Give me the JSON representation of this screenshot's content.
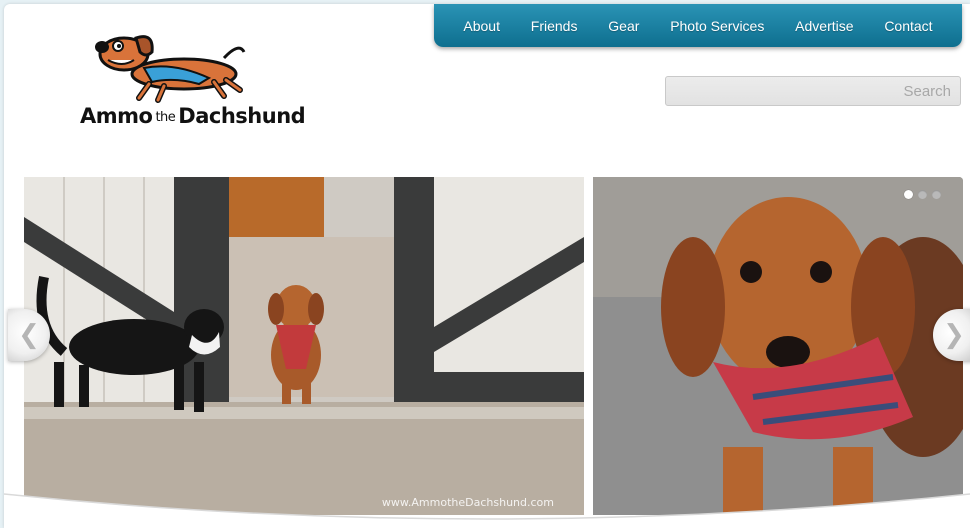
{
  "nav": {
    "items": [
      {
        "label": "About"
      },
      {
        "label": "Friends"
      },
      {
        "label": "Gear"
      },
      {
        "label": "Photo Services"
      },
      {
        "label": "Advertise"
      },
      {
        "label": "Contact"
      }
    ]
  },
  "logo": {
    "text_main_left": "Ammo",
    "text_the": "the",
    "text_main_right": "Dachshund"
  },
  "search": {
    "placeholder": "Search",
    "value": ""
  },
  "slider": {
    "watermark": "www.AmmotheDachshund.com",
    "dots_count": 3,
    "active_dot": 1
  },
  "colors": {
    "nav_bg": "#0e6f8f",
    "accent": "#2a93b5",
    "page_bg": "#ffffff"
  }
}
